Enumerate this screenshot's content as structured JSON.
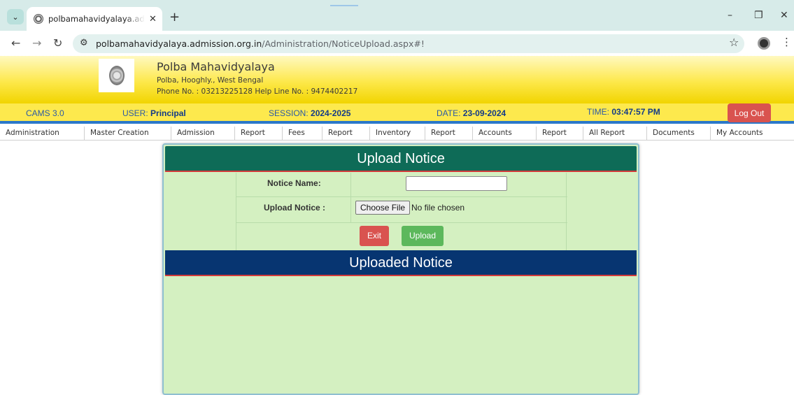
{
  "browser": {
    "tab_title": "polbamahavidyalaya.admission.org.in",
    "tab_close": "✕",
    "new_tab": "+",
    "url_host": "polbamahavidyalaya.admission.org.in",
    "url_path": "/Administration/NoticeUpload.aspx#!",
    "icons": [
      "tab-list-icon",
      "back-icon",
      "forward-icon",
      "reload-icon",
      "site-info-icon",
      "bookmark-star-icon",
      "profile-icon",
      "menu-icon",
      "minimize-icon",
      "restore-icon",
      "close-icon"
    ]
  },
  "header": {
    "college_name": "Polba Mahavidyalaya",
    "address": "Polba, Hooghly., West Bengal",
    "phone": "Phone No. : 03213225128  Help Line No. : 9474402217"
  },
  "status": {
    "app_version": "CAMS 3.0",
    "user_label": "USER:",
    "user_value": "Principal",
    "session_label": "SESSION:",
    "session_value": "2024-2025",
    "date_label": "DATE:",
    "date_value": "23-09-2024",
    "time_label": "TIME:",
    "time_value": "03:47:57 PM",
    "logout_label": "Log Out"
  },
  "menu": [
    {
      "label": "Administration"
    },
    {
      "label": "Master Creation"
    },
    {
      "label": "Admission"
    },
    {
      "label": "Report"
    },
    {
      "label": "Fees"
    },
    {
      "label": "Report"
    },
    {
      "label": "Inventory"
    },
    {
      "label": "Report"
    },
    {
      "label": "Accounts"
    },
    {
      "label": "Report"
    },
    {
      "label": "All Report"
    },
    {
      "label": "Documents"
    },
    {
      "label": "My Accounts"
    }
  ],
  "panel": {
    "title": "Upload Notice",
    "notice_name_label": "Notice Name:",
    "notice_name_value": "",
    "upload_label": "Upload Notice :",
    "choose_file_label": "Choose File",
    "no_file_text": "No file chosen",
    "exit_label": "Exit",
    "upload_button_label": "Upload",
    "uploaded_title": "Uploaded Notice"
  },
  "colors": {
    "header_green": "#0e6b57",
    "header_navy": "#073571",
    "panel_bg": "#d4f0c1",
    "danger": "#d9534f",
    "success": "#5cb85c",
    "banner_yellow": "#fde94d"
  }
}
